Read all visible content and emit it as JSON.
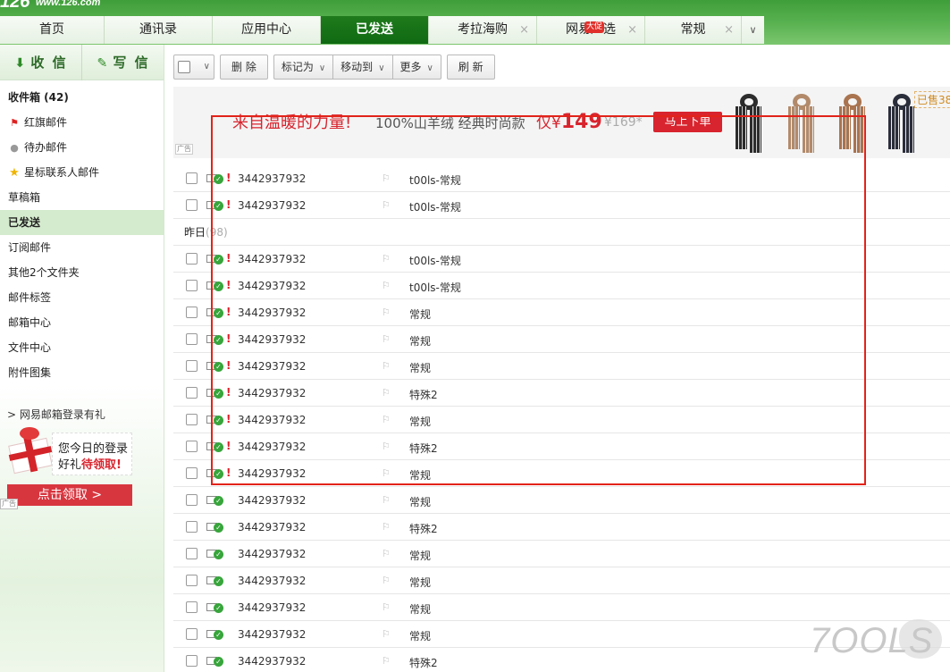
{
  "header": {
    "logo_mark": "126",
    "logo_url": "www.126.com"
  },
  "tabs": [
    {
      "label": "首页",
      "closable": false,
      "active": false
    },
    {
      "label": "通讯录",
      "closable": false,
      "active": false
    },
    {
      "label": "应用中心",
      "closable": false,
      "active": false
    },
    {
      "label": "已发送",
      "closable": false,
      "active": true
    },
    {
      "label": "考拉海购",
      "closable": true,
      "active": false
    },
    {
      "label": "网易严选",
      "closable": true,
      "active": false,
      "badge": "大促"
    },
    {
      "label": "常规",
      "closable": true,
      "active": false
    }
  ],
  "tab_close_glyph": "×",
  "tab_more_glyph": "∨",
  "sidebar": {
    "receive_label": "收 信",
    "write_label": "写 信",
    "folders": [
      {
        "label": "收件箱 (42)",
        "icon": "",
        "bold": true
      },
      {
        "label": "红旗邮件",
        "icon": "red-flag-icon"
      },
      {
        "label": "待办邮件",
        "icon": "clock-icon"
      },
      {
        "label": "星标联系人邮件",
        "icon": "star-icon"
      },
      {
        "label": "草稿箱",
        "icon": ""
      },
      {
        "label": "已发送",
        "icon": "",
        "active": true
      },
      {
        "label": "订阅邮件",
        "icon": ""
      },
      {
        "label": "其他2个文件夹",
        "icon": ""
      },
      {
        "label": "邮件标签",
        "icon": ""
      },
      {
        "label": "邮箱中心",
        "icon": ""
      },
      {
        "label": "文件中心",
        "icon": ""
      },
      {
        "label": "附件图集",
        "icon": ""
      }
    ],
    "promo": {
      "title": "> 网易邮箱登录有礼",
      "line1": "您今日的登录",
      "line2_prefix": "好礼",
      "line2_highlight": "待领取!",
      "button": "点击领取 >",
      "ad_tag": "广告"
    }
  },
  "toolbar": {
    "delete": "删 除",
    "mark_as": "标记为",
    "move_to": "移动到",
    "more": "更多",
    "refresh": "刷 新"
  },
  "banner": {
    "headline": "来自温暖的力量!",
    "sub": "100%山羊绒 经典时尚款",
    "price_prefix": "仅¥",
    "price": "149",
    "old_price": "¥169*",
    "cta": "马上下单",
    "sold": "已售38",
    "ad_tag": "广告",
    "scarf_colors": [
      "#2c2c2c",
      "#b28a6a",
      "#a9744f",
      "#2a2d3a"
    ]
  },
  "mail_list": {
    "today_rows": [
      {
        "sender": "3442937932",
        "subject": "t00ls-常规",
        "icon": "envelope-check-icon"
      },
      {
        "sender": "3442937932",
        "subject": "t00ls-常规",
        "icon": "envelope-check-icon"
      }
    ],
    "yesterday_label": "昨日",
    "yesterday_count": "(98)",
    "yesterday_rows": [
      {
        "sender": "3442937932",
        "subject": "t00ls-常规",
        "important": true
      },
      {
        "sender": "3442937932",
        "subject": "t00ls-常规",
        "important": true
      },
      {
        "sender": "3442937932",
        "subject": "常规",
        "important": true
      },
      {
        "sender": "3442937932",
        "subject": "常规",
        "important": true
      },
      {
        "sender": "3442937932",
        "subject": "常规",
        "important": true
      },
      {
        "sender": "3442937932",
        "subject": "特殊2",
        "important": true
      },
      {
        "sender": "3442937932",
        "subject": "常规",
        "important": true
      },
      {
        "sender": "3442937932",
        "subject": "特殊2",
        "important": true
      },
      {
        "sender": "3442937932",
        "subject": "常规",
        "important": true
      },
      {
        "sender": "3442937932",
        "subject": "常规",
        "important": false
      },
      {
        "sender": "3442937932",
        "subject": "特殊2",
        "important": false
      },
      {
        "sender": "3442937932",
        "subject": "常规",
        "important": false
      },
      {
        "sender": "3442937932",
        "subject": "常规",
        "important": false
      },
      {
        "sender": "3442937932",
        "subject": "常规",
        "important": false
      },
      {
        "sender": "3442937932",
        "subject": "常规",
        "important": false
      },
      {
        "sender": "3442937932",
        "subject": "特殊2",
        "important": false
      }
    ],
    "important_glyph": "!",
    "flag_glyph": "⚐"
  },
  "watermark": {
    "text": "7OOLS"
  },
  "colors": {
    "brand_green": "#0f6a12",
    "highlight_red": "#e2231a",
    "accent_red": "#d8242e"
  }
}
